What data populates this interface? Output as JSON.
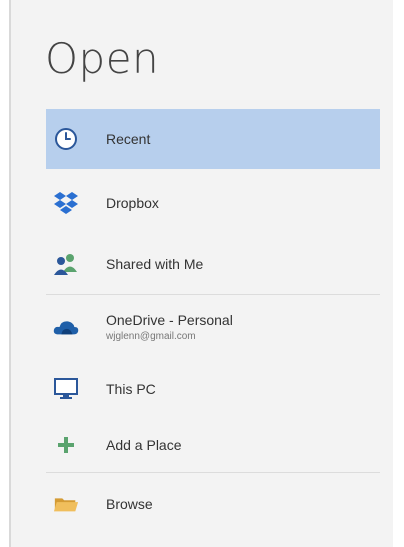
{
  "page": {
    "title": "Open"
  },
  "places": [
    {
      "id": "recent",
      "label": "Recent",
      "icon": "clock-icon",
      "selected": true
    },
    {
      "id": "dropbox",
      "label": "Dropbox",
      "icon": "dropbox-icon"
    },
    {
      "id": "shared",
      "label": "Shared with Me",
      "icon": "people-icon"
    },
    {
      "id": "onedrive",
      "label": "OneDrive - Personal",
      "sublabel": "wjglenn@gmail.com",
      "icon": "cloud-icon"
    },
    {
      "id": "thispc",
      "label": "This PC",
      "icon": "monitor-icon"
    },
    {
      "id": "addplace",
      "label": "Add a Place",
      "icon": "plus-icon"
    },
    {
      "id": "browse",
      "label": "Browse",
      "icon": "folder-icon"
    }
  ],
  "colors": {
    "selected_bg": "#b7cfed",
    "onedrive_blue": "#1f5fa8",
    "dropbox_blue": "#2a6fd1",
    "add_green": "#5aa36e",
    "folder_yellow": "#e8b04a"
  }
}
